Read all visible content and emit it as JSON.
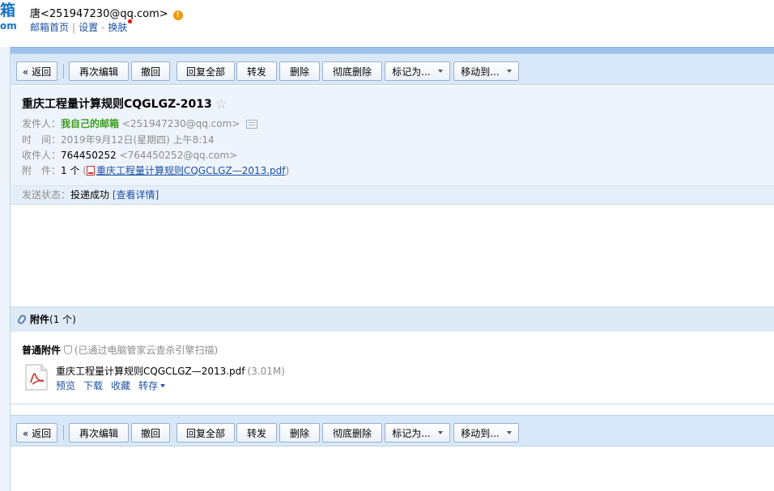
{
  "header": {
    "logo_line1": "箱",
    "logo_line2": "om",
    "user_name": "唐",
    "user_email": "<251947230@qq.com>",
    "warn_glyph": "!",
    "nav": {
      "home": "邮箱首页",
      "sep": "|",
      "settings": "设置",
      "dash": "-",
      "skin": "换肤"
    }
  },
  "toolbar": {
    "back": "« 返回",
    "reedit": "再次编辑",
    "recall": "撤回",
    "reply_all": "回复全部",
    "forward": "转发",
    "delete": "删除",
    "perm_delete": "彻底删除",
    "mark_as": "标记为...",
    "move_to": "移动到..."
  },
  "mail": {
    "subject": "重庆工程量计算规则CQGLGZ-2013",
    "star_glyph": "☆",
    "from_label": "发件人：",
    "from_name": "我自己的邮箱",
    "from_addr": "<251947230@qq.com>",
    "time_label": "时　间：",
    "time_value": "2019年9月12日(星期四) 上午8:14",
    "to_label": "收件人：",
    "to_name": "764450252",
    "to_addr": "<764450252@qq.com>",
    "att_label": "附　件：",
    "att_count": "1 个",
    "att_paren_open": "(",
    "att_link": "重庆工程量计算规则CQGCLGZ—2013.pdf",
    "att_paren_close": ")",
    "status_label": "发送状态：",
    "status_value": "投递成功",
    "status_link": "[查看详情]"
  },
  "attachments": {
    "title": "附件",
    "count": "(1 个)",
    "kind_label": "普通附件",
    "scan_note": "(已通过电脑管家云查杀引擎扫描)",
    "file_name": "重庆工程量计算规则CQGCLGZ—2013.pdf",
    "file_size": "(3.01M)",
    "actions": {
      "preview": "预览",
      "download": "下载",
      "favorite": "收藏",
      "save_to": "转存"
    }
  },
  "colors": {
    "accent_blue": "#1e50a2",
    "frame_blue": "#9ec3ea",
    "toolbar_bg": "#d9e8f8",
    "sender_green": "#3b9b1e",
    "warn_orange": "#f39800",
    "pdf_red": "#c9302c"
  }
}
